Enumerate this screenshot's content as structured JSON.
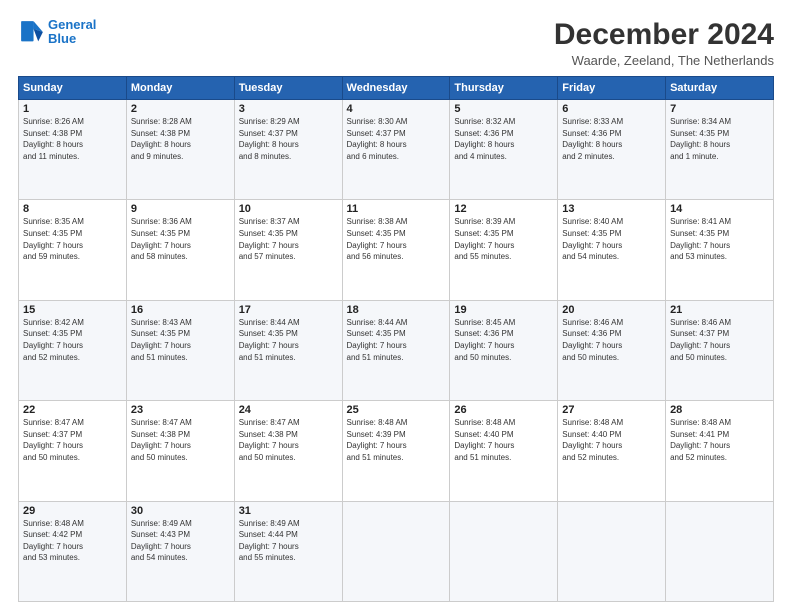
{
  "header": {
    "logo_line1": "General",
    "logo_line2": "Blue",
    "title": "December 2024",
    "subtitle": "Waarde, Zeeland, The Netherlands"
  },
  "columns": [
    "Sunday",
    "Monday",
    "Tuesday",
    "Wednesday",
    "Thursday",
    "Friday",
    "Saturday"
  ],
  "weeks": [
    [
      {
        "day": "1",
        "info": "Sunrise: 8:26 AM\nSunset: 4:38 PM\nDaylight: 8 hours\nand 11 minutes."
      },
      {
        "day": "2",
        "info": "Sunrise: 8:28 AM\nSunset: 4:38 PM\nDaylight: 8 hours\nand 9 minutes."
      },
      {
        "day": "3",
        "info": "Sunrise: 8:29 AM\nSunset: 4:37 PM\nDaylight: 8 hours\nand 8 minutes."
      },
      {
        "day": "4",
        "info": "Sunrise: 8:30 AM\nSunset: 4:37 PM\nDaylight: 8 hours\nand 6 minutes."
      },
      {
        "day": "5",
        "info": "Sunrise: 8:32 AM\nSunset: 4:36 PM\nDaylight: 8 hours\nand 4 minutes."
      },
      {
        "day": "6",
        "info": "Sunrise: 8:33 AM\nSunset: 4:36 PM\nDaylight: 8 hours\nand 2 minutes."
      },
      {
        "day": "7",
        "info": "Sunrise: 8:34 AM\nSunset: 4:35 PM\nDaylight: 8 hours\nand 1 minute."
      }
    ],
    [
      {
        "day": "8",
        "info": "Sunrise: 8:35 AM\nSunset: 4:35 PM\nDaylight: 7 hours\nand 59 minutes."
      },
      {
        "day": "9",
        "info": "Sunrise: 8:36 AM\nSunset: 4:35 PM\nDaylight: 7 hours\nand 58 minutes."
      },
      {
        "day": "10",
        "info": "Sunrise: 8:37 AM\nSunset: 4:35 PM\nDaylight: 7 hours\nand 57 minutes."
      },
      {
        "day": "11",
        "info": "Sunrise: 8:38 AM\nSunset: 4:35 PM\nDaylight: 7 hours\nand 56 minutes."
      },
      {
        "day": "12",
        "info": "Sunrise: 8:39 AM\nSunset: 4:35 PM\nDaylight: 7 hours\nand 55 minutes."
      },
      {
        "day": "13",
        "info": "Sunrise: 8:40 AM\nSunset: 4:35 PM\nDaylight: 7 hours\nand 54 minutes."
      },
      {
        "day": "14",
        "info": "Sunrise: 8:41 AM\nSunset: 4:35 PM\nDaylight: 7 hours\nand 53 minutes."
      }
    ],
    [
      {
        "day": "15",
        "info": "Sunrise: 8:42 AM\nSunset: 4:35 PM\nDaylight: 7 hours\nand 52 minutes."
      },
      {
        "day": "16",
        "info": "Sunrise: 8:43 AM\nSunset: 4:35 PM\nDaylight: 7 hours\nand 51 minutes."
      },
      {
        "day": "17",
        "info": "Sunrise: 8:44 AM\nSunset: 4:35 PM\nDaylight: 7 hours\nand 51 minutes."
      },
      {
        "day": "18",
        "info": "Sunrise: 8:44 AM\nSunset: 4:35 PM\nDaylight: 7 hours\nand 51 minutes."
      },
      {
        "day": "19",
        "info": "Sunrise: 8:45 AM\nSunset: 4:36 PM\nDaylight: 7 hours\nand 50 minutes."
      },
      {
        "day": "20",
        "info": "Sunrise: 8:46 AM\nSunset: 4:36 PM\nDaylight: 7 hours\nand 50 minutes."
      },
      {
        "day": "21",
        "info": "Sunrise: 8:46 AM\nSunset: 4:37 PM\nDaylight: 7 hours\nand 50 minutes."
      }
    ],
    [
      {
        "day": "22",
        "info": "Sunrise: 8:47 AM\nSunset: 4:37 PM\nDaylight: 7 hours\nand 50 minutes."
      },
      {
        "day": "23",
        "info": "Sunrise: 8:47 AM\nSunset: 4:38 PM\nDaylight: 7 hours\nand 50 minutes."
      },
      {
        "day": "24",
        "info": "Sunrise: 8:47 AM\nSunset: 4:38 PM\nDaylight: 7 hours\nand 50 minutes."
      },
      {
        "day": "25",
        "info": "Sunrise: 8:48 AM\nSunset: 4:39 PM\nDaylight: 7 hours\nand 51 minutes."
      },
      {
        "day": "26",
        "info": "Sunrise: 8:48 AM\nSunset: 4:40 PM\nDaylight: 7 hours\nand 51 minutes."
      },
      {
        "day": "27",
        "info": "Sunrise: 8:48 AM\nSunset: 4:40 PM\nDaylight: 7 hours\nand 52 minutes."
      },
      {
        "day": "28",
        "info": "Sunrise: 8:48 AM\nSunset: 4:41 PM\nDaylight: 7 hours\nand 52 minutes."
      }
    ],
    [
      {
        "day": "29",
        "info": "Sunrise: 8:48 AM\nSunset: 4:42 PM\nDaylight: 7 hours\nand 53 minutes."
      },
      {
        "day": "30",
        "info": "Sunrise: 8:49 AM\nSunset: 4:43 PM\nDaylight: 7 hours\nand 54 minutes."
      },
      {
        "day": "31",
        "info": "Sunrise: 8:49 AM\nSunset: 4:44 PM\nDaylight: 7 hours\nand 55 minutes."
      },
      {
        "day": "",
        "info": ""
      },
      {
        "day": "",
        "info": ""
      },
      {
        "day": "",
        "info": ""
      },
      {
        "day": "",
        "info": ""
      }
    ]
  ]
}
